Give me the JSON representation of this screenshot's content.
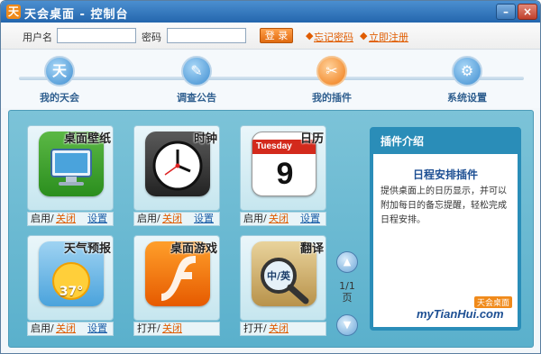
{
  "window": {
    "title": "天会桌面 - 控制台",
    "app_icon_glyph": "天",
    "minimize_glyph": "–",
    "close_glyph": "×"
  },
  "login": {
    "username_label": "用户名",
    "username_value": "",
    "password_label": "密码",
    "password_value": "",
    "login_button": "登 录",
    "forgot_link": "忘记密码",
    "register_link": "立即注册"
  },
  "nav": [
    {
      "label": "我的天会",
      "icon": "tianhui-logo-icon",
      "glyph": "天",
      "active": false
    },
    {
      "label": "调查公告",
      "icon": "pencil-icon",
      "glyph": "✎",
      "active": false
    },
    {
      "label": "我的插件",
      "icon": "tools-icon",
      "glyph": "✂",
      "active": true
    },
    {
      "label": "系统设置",
      "icon": "gear-icon",
      "glyph": "⚙",
      "active": false
    }
  ],
  "plugins": [
    {
      "name": "桌面壁纸",
      "icon": "desktop-wallpaper-icon",
      "enable": "启用",
      "disable": "关闭",
      "settings": "设置"
    },
    {
      "name": "时钟",
      "icon": "clock-icon",
      "enable": "启用",
      "disable": "关闭",
      "settings": "设置"
    },
    {
      "name": "日历",
      "icon": "calendar-icon",
      "enable": "启用",
      "disable": "关闭",
      "settings": "设置",
      "weekday": "Tuesday",
      "day": "9"
    },
    {
      "name": "天气预报",
      "icon": "weather-icon",
      "enable": "启用",
      "disable": "关闭",
      "settings": "设置",
      "temperature": "37°"
    },
    {
      "name": "桌面游戏",
      "icon": "flash-game-icon",
      "enable": "打开",
      "disable": "关闭"
    },
    {
      "name": "翻译",
      "icon": "magnifier-translate-icon",
      "enable": "打开",
      "disable": "关闭",
      "badge": "中/英"
    }
  ],
  "pager": {
    "page": "1/1",
    "unit": "页"
  },
  "intro": {
    "header": "插件介绍",
    "title": "日程安排插件",
    "description": "提供桌面上的日历显示，并可以附加每日的备忘提醒，轻松完成日程安排。",
    "logo_text": "myTianHui.com",
    "logo_badge": "天会桌面"
  },
  "colors": {
    "titlebar": "#2466ad",
    "accent_orange": "#e05c00",
    "content_bg": "#6cbad3",
    "intro_border": "#2a8db8"
  }
}
